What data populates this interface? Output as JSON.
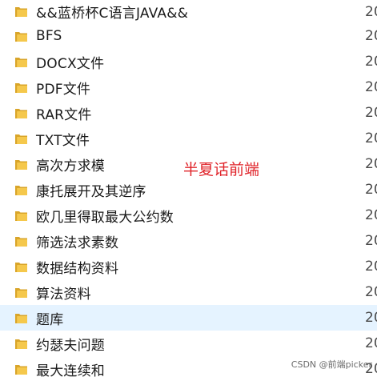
{
  "folders": [
    {
      "name": "&&蓝桥杯C语言JAVA&&",
      "date_fragment": "20"
    },
    {
      "name": "BFS",
      "date_fragment": "20"
    },
    {
      "name": "DOCX文件",
      "date_fragment": "20"
    },
    {
      "name": "PDF文件",
      "date_fragment": "20"
    },
    {
      "name": "RAR文件",
      "date_fragment": "20"
    },
    {
      "name": "TXT文件",
      "date_fragment": "20"
    },
    {
      "name": "高次方求模",
      "date_fragment": "20"
    },
    {
      "name": "康托展开及其逆序",
      "date_fragment": "20"
    },
    {
      "name": "欧几里得取最大公约数",
      "date_fragment": "20"
    },
    {
      "name": "筛选法求素数",
      "date_fragment": "20"
    },
    {
      "name": "数据结构资料",
      "date_fragment": "20"
    },
    {
      "name": "算法资料",
      "date_fragment": "20"
    },
    {
      "name": "题库",
      "date_fragment": "20",
      "selected": true
    },
    {
      "name": "约瑟夫问题",
      "date_fragment": "20"
    },
    {
      "name": "最大连续和",
      "date_fragment": "20"
    }
  ],
  "icon": "folder-icon",
  "colors": {
    "selection_bg": "#e5f3ff",
    "folder_yellow": "#f5c84c",
    "folder_dark": "#d9a52a",
    "watermark_red": "#e0242a"
  },
  "watermark_center": "半夏话前端",
  "watermark_corner": "CSDN @前端picker"
}
